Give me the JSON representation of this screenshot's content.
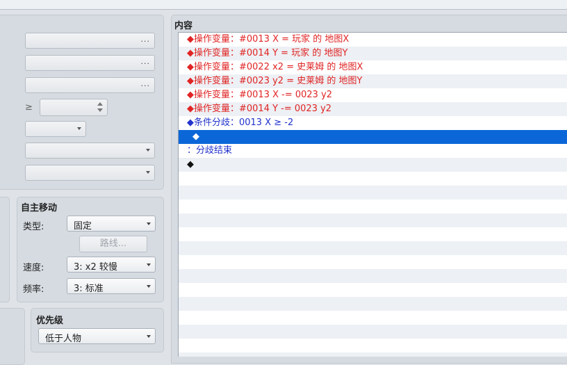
{
  "content_panel": {
    "title": "内容"
  },
  "event_list": [
    {
      "text": "◆操作变量：#0013 X = 玩家 的 地图X",
      "color": "red"
    },
    {
      "text": "◆操作变量：#0014 Y = 玩家 的 地图Y",
      "color": "red"
    },
    {
      "text": "◆操作变量：#0022 x2 = 史莱姆 的 地图X",
      "color": "red"
    },
    {
      "text": "◆操作变量：#0023 y2 = 史莱姆 的 地图Y",
      "color": "red"
    },
    {
      "text": "◆操作变量：#0013 X -= 0023 y2",
      "color": "red"
    },
    {
      "text": "◆操作变量：#0014 Y -= 0023 y2",
      "color": "red"
    },
    {
      "text": "◆条件分歧：0013 X ≥ -2",
      "color": "blue"
    },
    {
      "text": "◆",
      "color": "black",
      "selected": true
    },
    {
      "text": "：分歧结束",
      "color": "blue"
    },
    {
      "text": "◆",
      "color": "black"
    }
  ],
  "conditions": {
    "ellipsis": "...",
    "compare_symbol": "≥"
  },
  "autonomous_move": {
    "title": "自主移动",
    "type_label": "类型:",
    "type_value": "固定",
    "route_button": "路线...",
    "speed_label": "速度:",
    "speed_value": "3: x2 较慢",
    "freq_label": "频率:",
    "freq_value": "3: 标准"
  },
  "priority": {
    "title": "优先级",
    "value": "低于人物"
  },
  "colors": {
    "red": "#e02424",
    "blue": "#2233cc",
    "selection": "#0b67d8"
  }
}
